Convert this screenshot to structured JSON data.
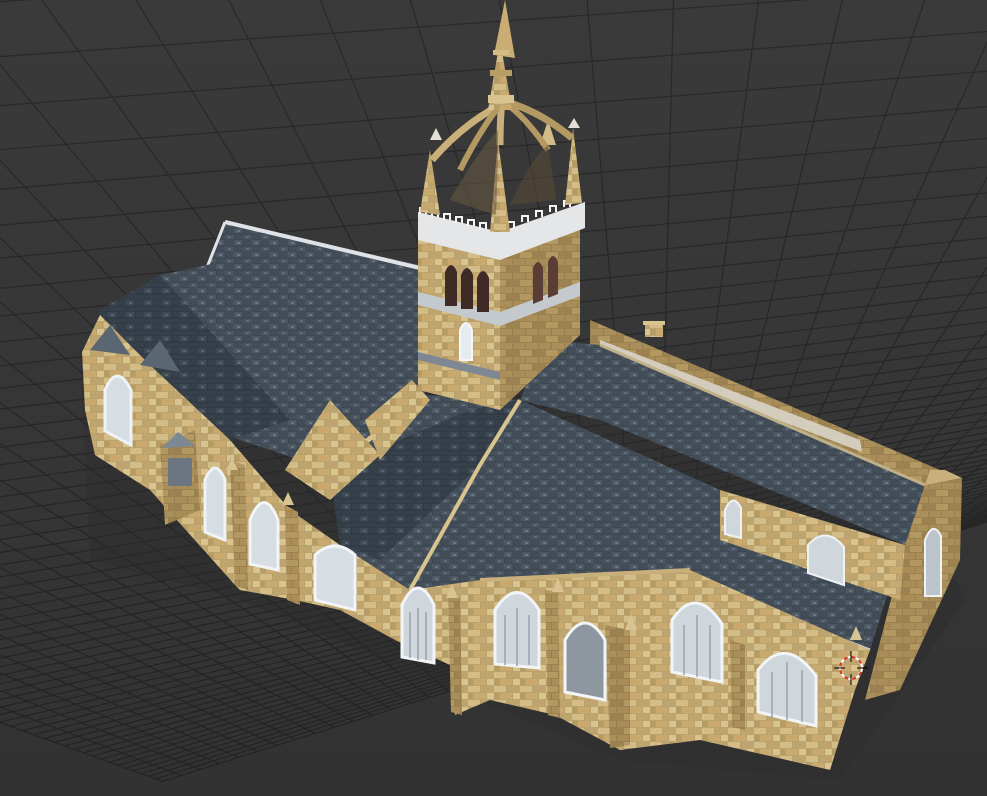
{
  "viewport": {
    "background_color": "#3d3d3d",
    "grid_line_color": "#2b2b2b",
    "grid": true,
    "projection": "perspective"
  },
  "model": {
    "wall_color": "#c9b07a",
    "wall_shadow_color": "#a48a56",
    "wall_stone_color": "#b49a62",
    "roof_color": "#3f4a55",
    "roof_highlight_color": "#5c6874",
    "roof_edge_color": "#b8bec6",
    "window_color": "#d6dde3",
    "window_frame_color": "#eef2f5",
    "pinnacle_color": "#d2bb86"
  },
  "overlays": {
    "cursor_3d_icon": "3d-cursor-icon",
    "cursor_color_primary": "#d63a2a",
    "cursor_color_secondary": "#ffffff"
  }
}
